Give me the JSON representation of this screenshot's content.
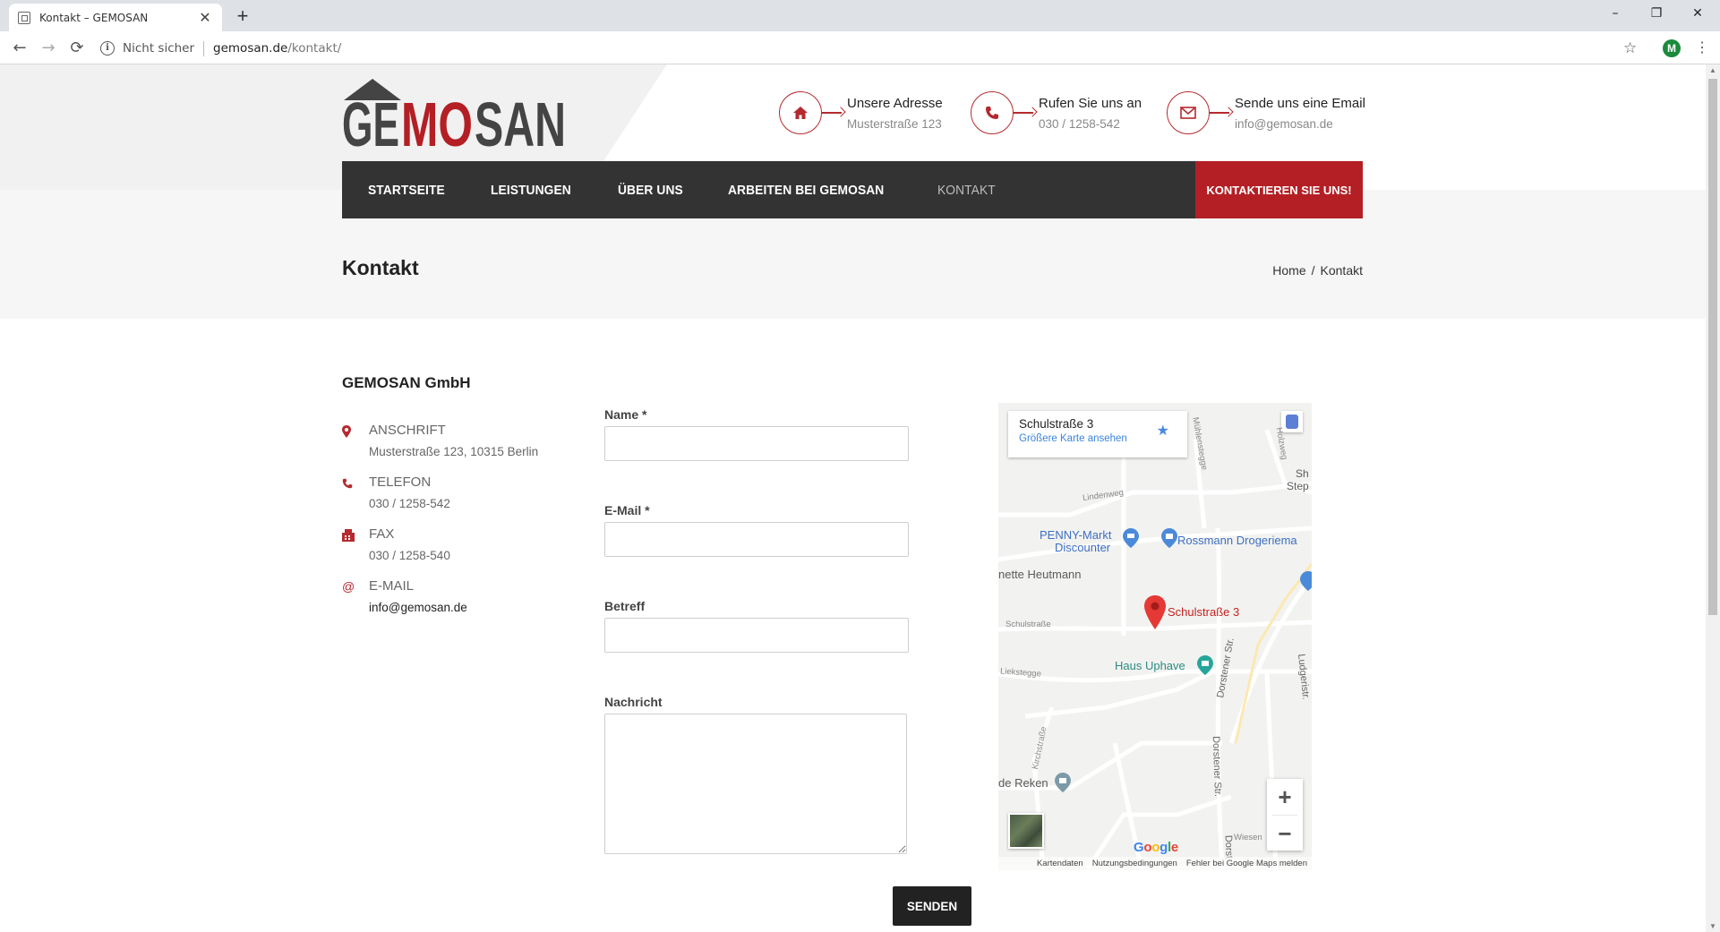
{
  "browser": {
    "tab_title": "Kontakt – GEMOSAN",
    "tab_close": "✕",
    "new_tab": "+",
    "security_label": "Nicht sicher",
    "url_host": "gemosan.de",
    "url_path": "/kontakt/",
    "profile_initial": "M",
    "window_controls": [
      "–",
      "❐",
      "✕"
    ]
  },
  "header": {
    "logo_text_left": "GE",
    "logo_text_mid": "MO",
    "logo_text_right": "SAN",
    "contacts": [
      {
        "title": "Unsere Adresse",
        "value": "Musterstraße 123",
        "icon": "house-icon"
      },
      {
        "title": "Rufen Sie uns an",
        "value": "030 / 1258-542",
        "icon": "phone-icon"
      },
      {
        "title": "Sende uns eine Email",
        "value": "info@gemosan.de",
        "icon": "envelope-icon"
      }
    ]
  },
  "nav": {
    "items": [
      "STARTSEITE",
      "LEISTUNGEN",
      "ÜBER UNS",
      "ARBEITEN BEI GEMOSAN",
      "KONTAKT"
    ],
    "active_index": 4,
    "cta": "KONTAKTIEREN SIE UNS!"
  },
  "page": {
    "title": "Kontakt",
    "breadcrumb": [
      "Home",
      "/",
      "Kontakt"
    ]
  },
  "company": {
    "name": "GEMOSAN GmbH",
    "items": [
      {
        "label": "ANSCHRIFT",
        "value": "Musterstraße 123, 10315 Berlin",
        "icon": "map-pin-icon"
      },
      {
        "label": "TELEFON",
        "value": "030 / 1258-542",
        "icon": "phone-icon"
      },
      {
        "label": "FAX",
        "value": "030 / 1258-540",
        "icon": "fax-icon"
      },
      {
        "label": "E-MAIL",
        "value": "info@gemosan.de",
        "icon": "at-icon"
      }
    ]
  },
  "form": {
    "name_label": "Name *",
    "email_label": "E-Mail *",
    "subject_label": "Betreff",
    "message_label": "Nachricht",
    "submit": "SENDEN"
  },
  "map": {
    "card_title": "Schulstraße 3",
    "card_link": "Größere Karte ansehen",
    "marker_label": "Schulstraße 3",
    "places": [
      "PENNY-Markt",
      "Discounter",
      "Rossmann Drogeriema",
      "nette Heutmann",
      "Haus Uphave",
      "de Reken",
      "Sh",
      "Step"
    ],
    "streets": [
      "Lindenweg",
      "Schulstraße",
      "Liekstegge",
      "Dorstener Str.",
      "Dorstener Str.",
      "Kirchstraße",
      "Wiesen",
      "Mühlenstegge",
      "Ludgeristr.",
      "Holzweg",
      "Dorst"
    ],
    "google": "Google",
    "footer": [
      "Kartendaten",
      "Nutzungsbedingungen",
      "Fehler bei Google Maps melden"
    ],
    "zoom_in": "+",
    "zoom_out": "−"
  },
  "colors": {
    "brand_red": "#b31f24",
    "nav_bg": "#333333",
    "link_blue": "#3a84df"
  }
}
